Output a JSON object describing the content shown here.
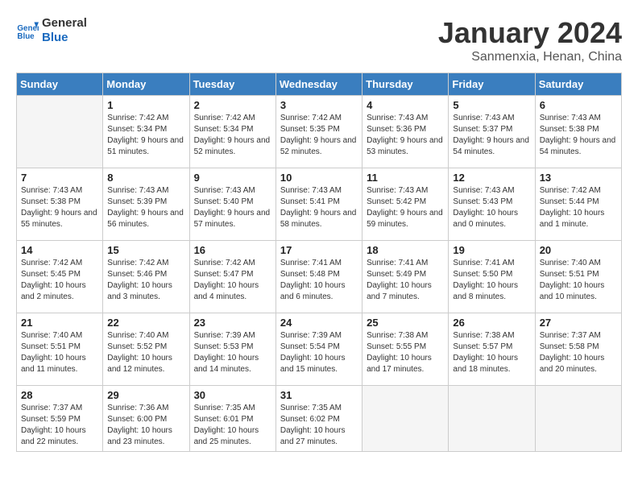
{
  "header": {
    "logo_line1": "General",
    "logo_line2": "Blue",
    "month_title": "January 2024",
    "location": "Sanmenxia, Henan, China"
  },
  "days_of_week": [
    "Sunday",
    "Monday",
    "Tuesday",
    "Wednesday",
    "Thursday",
    "Friday",
    "Saturday"
  ],
  "weeks": [
    [
      {
        "day": "",
        "sunrise": "",
        "sunset": "",
        "daylight": ""
      },
      {
        "day": "1",
        "sunrise": "7:42 AM",
        "sunset": "5:34 PM",
        "daylight": "9 hours and 51 minutes."
      },
      {
        "day": "2",
        "sunrise": "7:42 AM",
        "sunset": "5:34 PM",
        "daylight": "9 hours and 52 minutes."
      },
      {
        "day": "3",
        "sunrise": "7:42 AM",
        "sunset": "5:35 PM",
        "daylight": "9 hours and 52 minutes."
      },
      {
        "day": "4",
        "sunrise": "7:43 AM",
        "sunset": "5:36 PM",
        "daylight": "9 hours and 53 minutes."
      },
      {
        "day": "5",
        "sunrise": "7:43 AM",
        "sunset": "5:37 PM",
        "daylight": "9 hours and 54 minutes."
      },
      {
        "day": "6",
        "sunrise": "7:43 AM",
        "sunset": "5:38 PM",
        "daylight": "9 hours and 54 minutes."
      }
    ],
    [
      {
        "day": "7",
        "sunrise": "7:43 AM",
        "sunset": "5:38 PM",
        "daylight": "9 hours and 55 minutes."
      },
      {
        "day": "8",
        "sunrise": "7:43 AM",
        "sunset": "5:39 PM",
        "daylight": "9 hours and 56 minutes."
      },
      {
        "day": "9",
        "sunrise": "7:43 AM",
        "sunset": "5:40 PM",
        "daylight": "9 hours and 57 minutes."
      },
      {
        "day": "10",
        "sunrise": "7:43 AM",
        "sunset": "5:41 PM",
        "daylight": "9 hours and 58 minutes."
      },
      {
        "day": "11",
        "sunrise": "7:43 AM",
        "sunset": "5:42 PM",
        "daylight": "9 hours and 59 minutes."
      },
      {
        "day": "12",
        "sunrise": "7:43 AM",
        "sunset": "5:43 PM",
        "daylight": "10 hours and 0 minutes."
      },
      {
        "day": "13",
        "sunrise": "7:42 AM",
        "sunset": "5:44 PM",
        "daylight": "10 hours and 1 minute."
      }
    ],
    [
      {
        "day": "14",
        "sunrise": "7:42 AM",
        "sunset": "5:45 PM",
        "daylight": "10 hours and 2 minutes."
      },
      {
        "day": "15",
        "sunrise": "7:42 AM",
        "sunset": "5:46 PM",
        "daylight": "10 hours and 3 minutes."
      },
      {
        "day": "16",
        "sunrise": "7:42 AM",
        "sunset": "5:47 PM",
        "daylight": "10 hours and 4 minutes."
      },
      {
        "day": "17",
        "sunrise": "7:41 AM",
        "sunset": "5:48 PM",
        "daylight": "10 hours and 6 minutes."
      },
      {
        "day": "18",
        "sunrise": "7:41 AM",
        "sunset": "5:49 PM",
        "daylight": "10 hours and 7 minutes."
      },
      {
        "day": "19",
        "sunrise": "7:41 AM",
        "sunset": "5:50 PM",
        "daylight": "10 hours and 8 minutes."
      },
      {
        "day": "20",
        "sunrise": "7:40 AM",
        "sunset": "5:51 PM",
        "daylight": "10 hours and 10 minutes."
      }
    ],
    [
      {
        "day": "21",
        "sunrise": "7:40 AM",
        "sunset": "5:51 PM",
        "daylight": "10 hours and 11 minutes."
      },
      {
        "day": "22",
        "sunrise": "7:40 AM",
        "sunset": "5:52 PM",
        "daylight": "10 hours and 12 minutes."
      },
      {
        "day": "23",
        "sunrise": "7:39 AM",
        "sunset": "5:53 PM",
        "daylight": "10 hours and 14 minutes."
      },
      {
        "day": "24",
        "sunrise": "7:39 AM",
        "sunset": "5:54 PM",
        "daylight": "10 hours and 15 minutes."
      },
      {
        "day": "25",
        "sunrise": "7:38 AM",
        "sunset": "5:55 PM",
        "daylight": "10 hours and 17 minutes."
      },
      {
        "day": "26",
        "sunrise": "7:38 AM",
        "sunset": "5:57 PM",
        "daylight": "10 hours and 18 minutes."
      },
      {
        "day": "27",
        "sunrise": "7:37 AM",
        "sunset": "5:58 PM",
        "daylight": "10 hours and 20 minutes."
      }
    ],
    [
      {
        "day": "28",
        "sunrise": "7:37 AM",
        "sunset": "5:59 PM",
        "daylight": "10 hours and 22 minutes."
      },
      {
        "day": "29",
        "sunrise": "7:36 AM",
        "sunset": "6:00 PM",
        "daylight": "10 hours and 23 minutes."
      },
      {
        "day": "30",
        "sunrise": "7:35 AM",
        "sunset": "6:01 PM",
        "daylight": "10 hours and 25 minutes."
      },
      {
        "day": "31",
        "sunrise": "7:35 AM",
        "sunset": "6:02 PM",
        "daylight": "10 hours and 27 minutes."
      },
      {
        "day": "",
        "sunrise": "",
        "sunset": "",
        "daylight": ""
      },
      {
        "day": "",
        "sunrise": "",
        "sunset": "",
        "daylight": ""
      },
      {
        "day": "",
        "sunrise": "",
        "sunset": "",
        "daylight": ""
      }
    ]
  ]
}
